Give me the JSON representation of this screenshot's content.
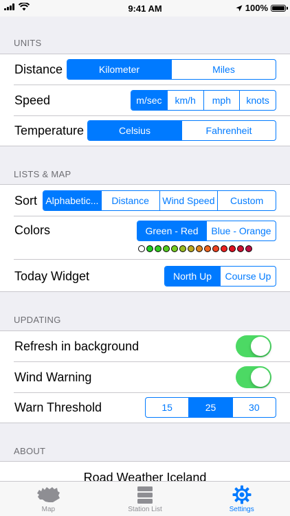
{
  "status_bar": {
    "time": "9:41 AM",
    "battery": "100%"
  },
  "sections": {
    "units": "UNITS",
    "lists_map": "LISTS & MAP",
    "updating": "UPDATING",
    "about": "ABOUT"
  },
  "units": {
    "distance": {
      "label": "Distance",
      "options": [
        "Kilometer",
        "Miles"
      ],
      "selected": 0
    },
    "speed": {
      "label": "Speed",
      "options": [
        "m/sec",
        "km/h",
        "mph",
        "knots"
      ],
      "selected": 0
    },
    "temperature": {
      "label": "Temperature",
      "options": [
        "Celsius",
        "Fahrenheit"
      ],
      "selected": 0
    }
  },
  "lists_map": {
    "sort": {
      "label": "Sort",
      "options": [
        "Alphabetic...",
        "Distance",
        "Wind Speed",
        "Custom"
      ],
      "selected": 0
    },
    "colors": {
      "label": "Colors",
      "options": [
        "Green - Red",
        "Blue - Orange"
      ],
      "selected": 0
    },
    "color_scale": [
      "#ffffff",
      "#22cc22",
      "#33cc22",
      "#55cc22",
      "#77cc22",
      "#99bb22",
      "#bbaa22",
      "#dd8822",
      "#ee6622",
      "#ee4422",
      "#ee2222",
      "#dd1122",
      "#cc1133",
      "#bb1144"
    ],
    "today_widget": {
      "label": "Today Widget",
      "options": [
        "North Up",
        "Course Up"
      ],
      "selected": 0
    }
  },
  "updating": {
    "refresh": {
      "label": "Refresh in background",
      "on": true
    },
    "wind_warning": {
      "label": "Wind Warning",
      "on": true
    },
    "warn_threshold": {
      "label": "Warn Threshold",
      "options": [
        "15",
        "25",
        "30"
      ],
      "selected": 1
    }
  },
  "about": {
    "title": "Road Weather Iceland"
  },
  "tab_bar": {
    "tabs": [
      {
        "label": "Map",
        "icon": "iceland-map-icon"
      },
      {
        "label": "Station List",
        "icon": "list-icon"
      },
      {
        "label": "Settings",
        "icon": "gear-icon"
      }
    ],
    "active": 2
  },
  "colors": {
    "accent": "#007aff",
    "toggle_on": "#4cd964",
    "background": "#efeff4"
  }
}
